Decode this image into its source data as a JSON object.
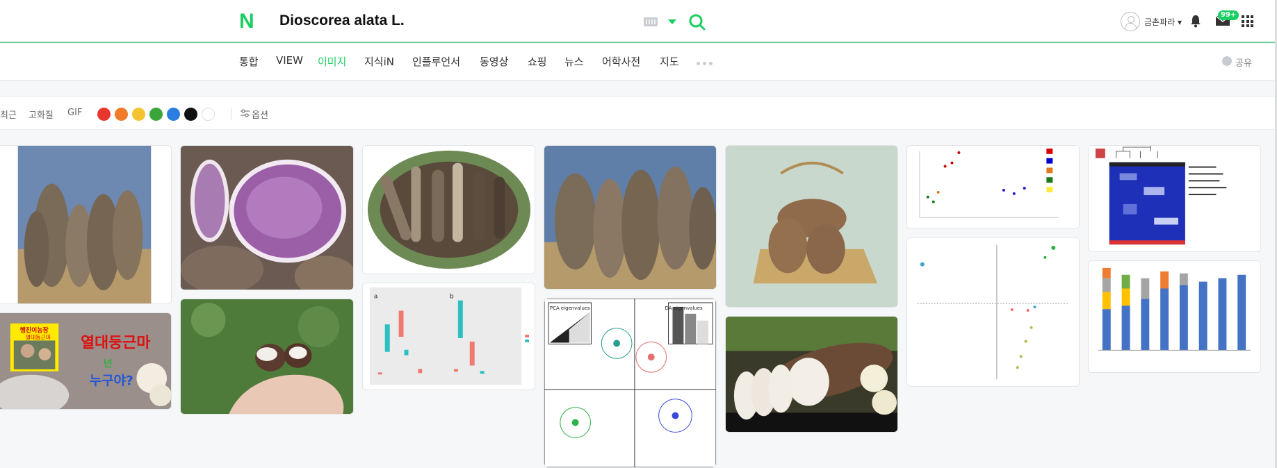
{
  "header": {
    "logo": "N",
    "query": "Dioscorea alata L.",
    "user_name": "금촌파라",
    "mail_badge": "99+"
  },
  "nav": {
    "tabs": [
      "통합",
      "VIEW",
      "이미지",
      "지식iN",
      "인플루언서",
      "동영상",
      "쇼핑",
      "뉴스",
      "어학사전",
      "지도"
    ],
    "active": "이미지",
    "share_label": "공유"
  },
  "filters": {
    "items": [
      "최근",
      "고화질",
      "GIF"
    ],
    "colors": [
      "#e8352e",
      "#f07b2b",
      "#f4c430",
      "#3aa53a",
      "#2a7de1",
      "#111111",
      "#ffffff"
    ],
    "options_label": "옵션"
  },
  "results": {
    "overlay_texts": {
      "thumb5_line1": "행진이농장",
      "thumb5_line2": "열대둥근마",
      "thumb5_main": "열대둥근마",
      "thumb5_sub": "넌",
      "thumb5_q": "누구야?",
      "thumb9_left": "PCA eigenvalues",
      "thumb9_right": "DA eigenvalues",
      "thumb7_a": "a",
      "thumb7_b": "b"
    }
  }
}
